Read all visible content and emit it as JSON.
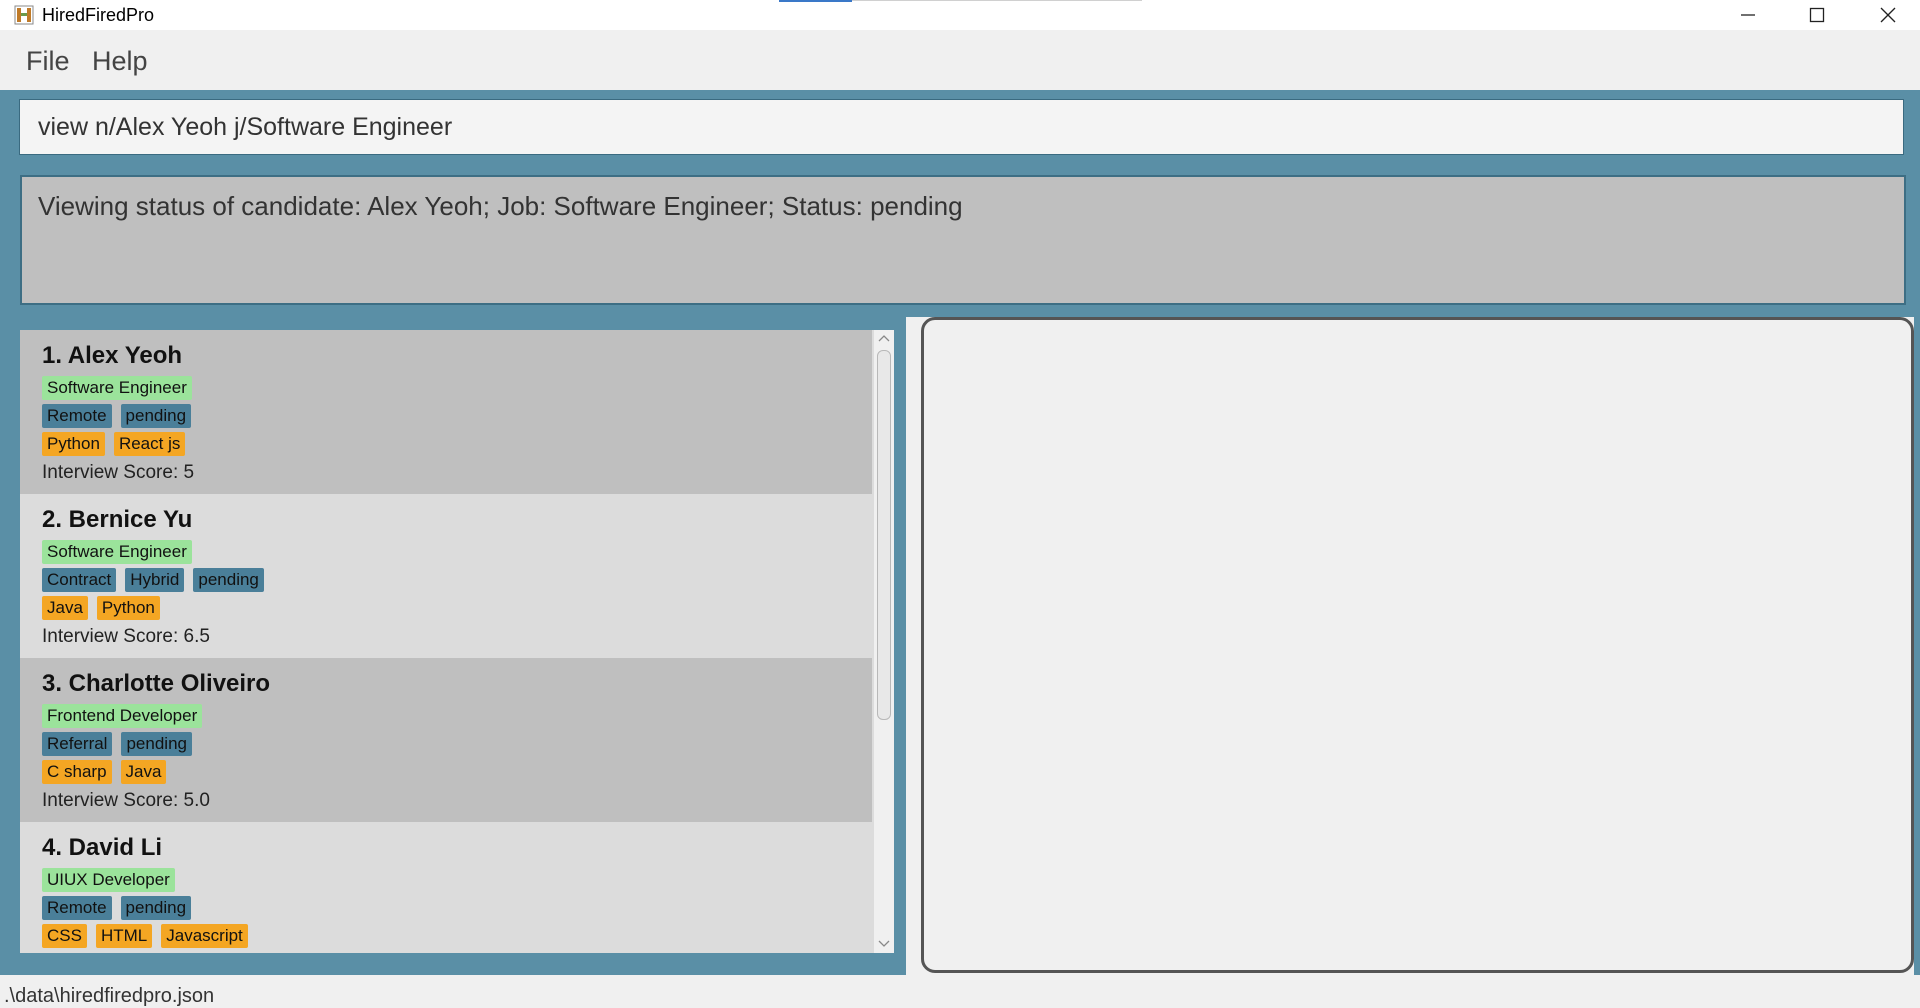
{
  "window": {
    "title": "HiredFiredPro"
  },
  "menu": {
    "file": "File",
    "help": "Help"
  },
  "command": {
    "value": "view n/Alex Yeoh j/Software Engineer"
  },
  "result": {
    "text": "Viewing status of candidate: Alex Yeoh; Job: Software Engineer; Status: pending"
  },
  "candidates": [
    {
      "name": "1. Alex Yeoh",
      "job": "Software Engineer",
      "meta": [
        "Remote",
        "pending"
      ],
      "skills": [
        "Python",
        "React js"
      ],
      "score": "Interview Score: 5"
    },
    {
      "name": "2. Bernice Yu",
      "job": "Software Engineer",
      "meta": [
        "Contract",
        "Hybrid",
        "pending"
      ],
      "skills": [
        "Java",
        "Python"
      ],
      "score": "Interview Score: 6.5"
    },
    {
      "name": "3. Charlotte Oliveiro",
      "job": "Frontend Developer",
      "meta": [
        "Referral",
        "pending"
      ],
      "skills": [
        "C sharp",
        "Java"
      ],
      "score": "Interview Score: 5.0"
    },
    {
      "name": "4. David Li",
      "job": "UIUX Developer",
      "meta": [
        "Remote",
        "pending"
      ],
      "skills": [
        "CSS",
        "HTML",
        "Javascript"
      ],
      "score": ""
    }
  ],
  "status_bar": {
    "path": ".\\data\\hiredfiredpro.json"
  },
  "colors": {
    "frame": "#5a8fa6",
    "job_tag": "#9be39b",
    "meta_tag": "#4a7f99",
    "skill_tag": "#f4a623"
  },
  "icons": {
    "app": "app-logo-icon",
    "minimize": "minimize-icon",
    "maximize": "maximize-icon",
    "close": "close-icon"
  }
}
